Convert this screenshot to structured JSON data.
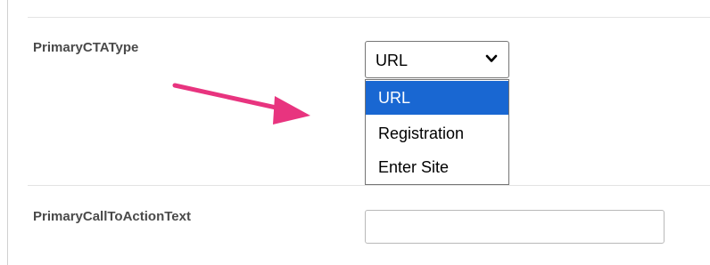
{
  "form": {
    "fields": [
      {
        "label": "PrimaryCTAType",
        "control": "select",
        "selected_value": "URL",
        "options": [
          "URL",
          "Registration",
          "Enter Site"
        ],
        "highlighted_option": "URL"
      },
      {
        "label": "PrimaryCallToActionText",
        "control": "text-input",
        "value": "",
        "placeholder": ""
      }
    ]
  },
  "annotation": {
    "icon": "arrow-right-icon",
    "color": "#e8347f"
  },
  "colors": {
    "option_highlight": "#1967d2",
    "label_text": "#4a4a4a",
    "divider": "#e3e3e3"
  }
}
